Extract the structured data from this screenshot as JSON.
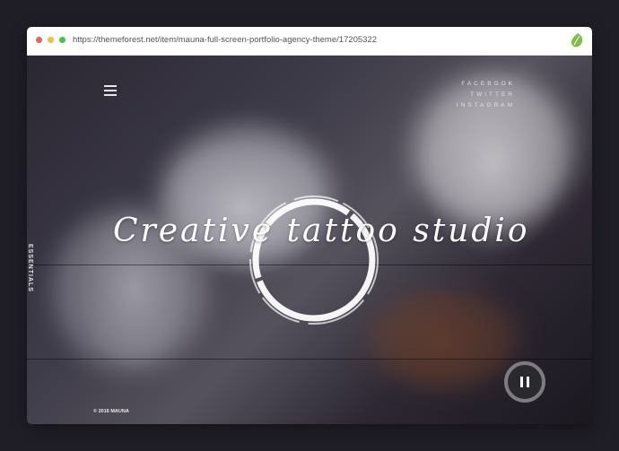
{
  "browser": {
    "url": "https://themeforest.net/item/mauna-full-screen-portfolio-agency-theme/17205322",
    "leaf_color": "#7cc144"
  },
  "site": {
    "social": [
      "FACEBOOK",
      "TWITTER",
      "INSTAGRAM"
    ],
    "side_label": "ESSENTIALS",
    "headline": "Creative tattoo studio",
    "copyright": "© 2016 MAUNA"
  },
  "colors": {
    "page_bg": "#1f1d26",
    "text": "#ffffff"
  }
}
